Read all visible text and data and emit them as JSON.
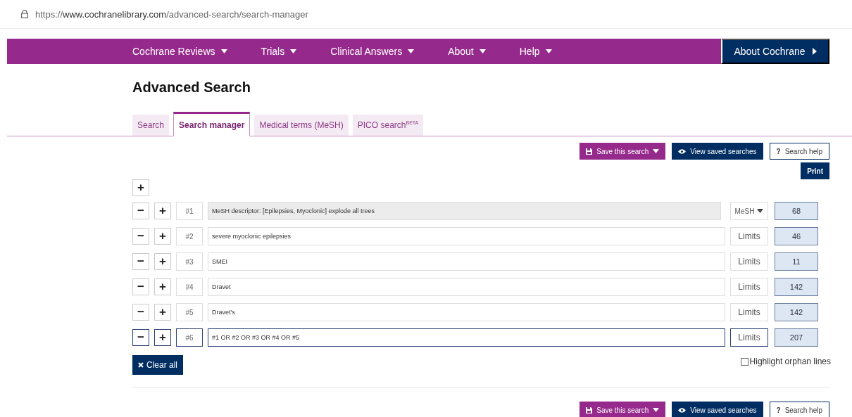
{
  "address_bar": {
    "url": "https://**www.cochranelibrary.com**/advanced-search/search-manager"
  },
  "nav": {
    "items": [
      {
        "label": "Cochrane Reviews"
      },
      {
        "label": "Trials"
      },
      {
        "label": "Clinical Answers"
      },
      {
        "label": "About"
      },
      {
        "label": "Help"
      }
    ],
    "about_button": "About Cochrane"
  },
  "page_title": "Advanced Search",
  "tabs": [
    {
      "label": "Search",
      "selected": false
    },
    {
      "label": "Search manager",
      "selected": true
    },
    {
      "label": "Medical terms (MeSH)",
      "selected": false
    },
    {
      "label": "PICO search$^{BETA}$",
      "selected": false
    }
  ],
  "toolbar_top": {
    "save": "Save this search",
    "view_saved": "View saved searches",
    "help_icon": "?",
    "help": "Search help"
  },
  "add_line": "+",
  "print": "Print",
  "lines": [
    {
      "number": "#1",
      "query": "MeSH descriptor: [Epilepsies, Myoclonic] explode all trees",
      "kind": "mesh",
      "option": "MeSH",
      "count": "68",
      "active": false
    },
    {
      "number": "#2",
      "query": "severe myoclonic epilepsies",
      "kind": "text",
      "option": "Limits",
      "count": "46",
      "active": false
    },
    {
      "number": "#3",
      "query": "SMEI",
      "kind": "text",
      "option": "Limits",
      "count": "11",
      "active": false
    },
    {
      "number": "#4",
      "query": "Dravet",
      "kind": "text",
      "option": "Limits",
      "count": "142",
      "active": false
    },
    {
      "number": "#5",
      "query": "Dravet's",
      "kind": "text",
      "option": "Limits",
      "count": "142",
      "active": false
    },
    {
      "number": "#6",
      "query": "#1 OR #2 OR #3 OR #4 OR #5",
      "kind": "text",
      "option": "Limits",
      "count": "207",
      "active": true
    }
  ],
  "line_buttons": {
    "remove": "−",
    "add": "+"
  },
  "clear_all": "Clear all",
  "highlight_orphans": {
    "label": "Highlight orphan lines",
    "checked": false
  },
  "toolbar_bottom": {
    "save": "Save this search",
    "view_saved": "View saved searches",
    "help_icon": "?",
    "help": "Search help"
  }
}
